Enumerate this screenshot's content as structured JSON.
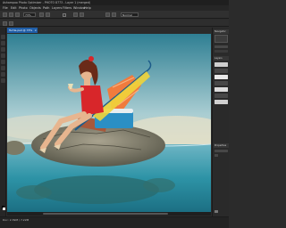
{
  "window": {
    "title": "Ashampoo Photo Optimizer - PHOTO 8773 - Layer 1 (merged)"
  },
  "menu": [
    "File",
    "Edit",
    "Photo",
    "Objects",
    "Path",
    "Layers",
    "Filters",
    "Window",
    "Help"
  ],
  "toolbar": {
    "zoom_value": "73%",
    "mode_label": "Normal",
    "opacity_value": "100"
  },
  "document": {
    "tab_label": "Turtle.psd @ 73%",
    "close_glyph": "×"
  },
  "panels": {
    "navigator_label": "Navigator",
    "layers_label": "Layers",
    "history_label": "Properties"
  },
  "status": {
    "text": "Doc: 2.39M / 7.22M"
  },
  "colors": {
    "accent": "#1f5ea8",
    "sea": "#2f8ba3",
    "sky": "#9fc7cf",
    "dress": "#d8262a",
    "chair": "#f07b3d",
    "cooler": "#2b8fc4"
  },
  "icons": [
    "move-icon",
    "marquee-icon",
    "lasso-icon",
    "crop-icon",
    "brush-icon",
    "eraser-icon",
    "zoom-icon",
    "hand-icon"
  ]
}
